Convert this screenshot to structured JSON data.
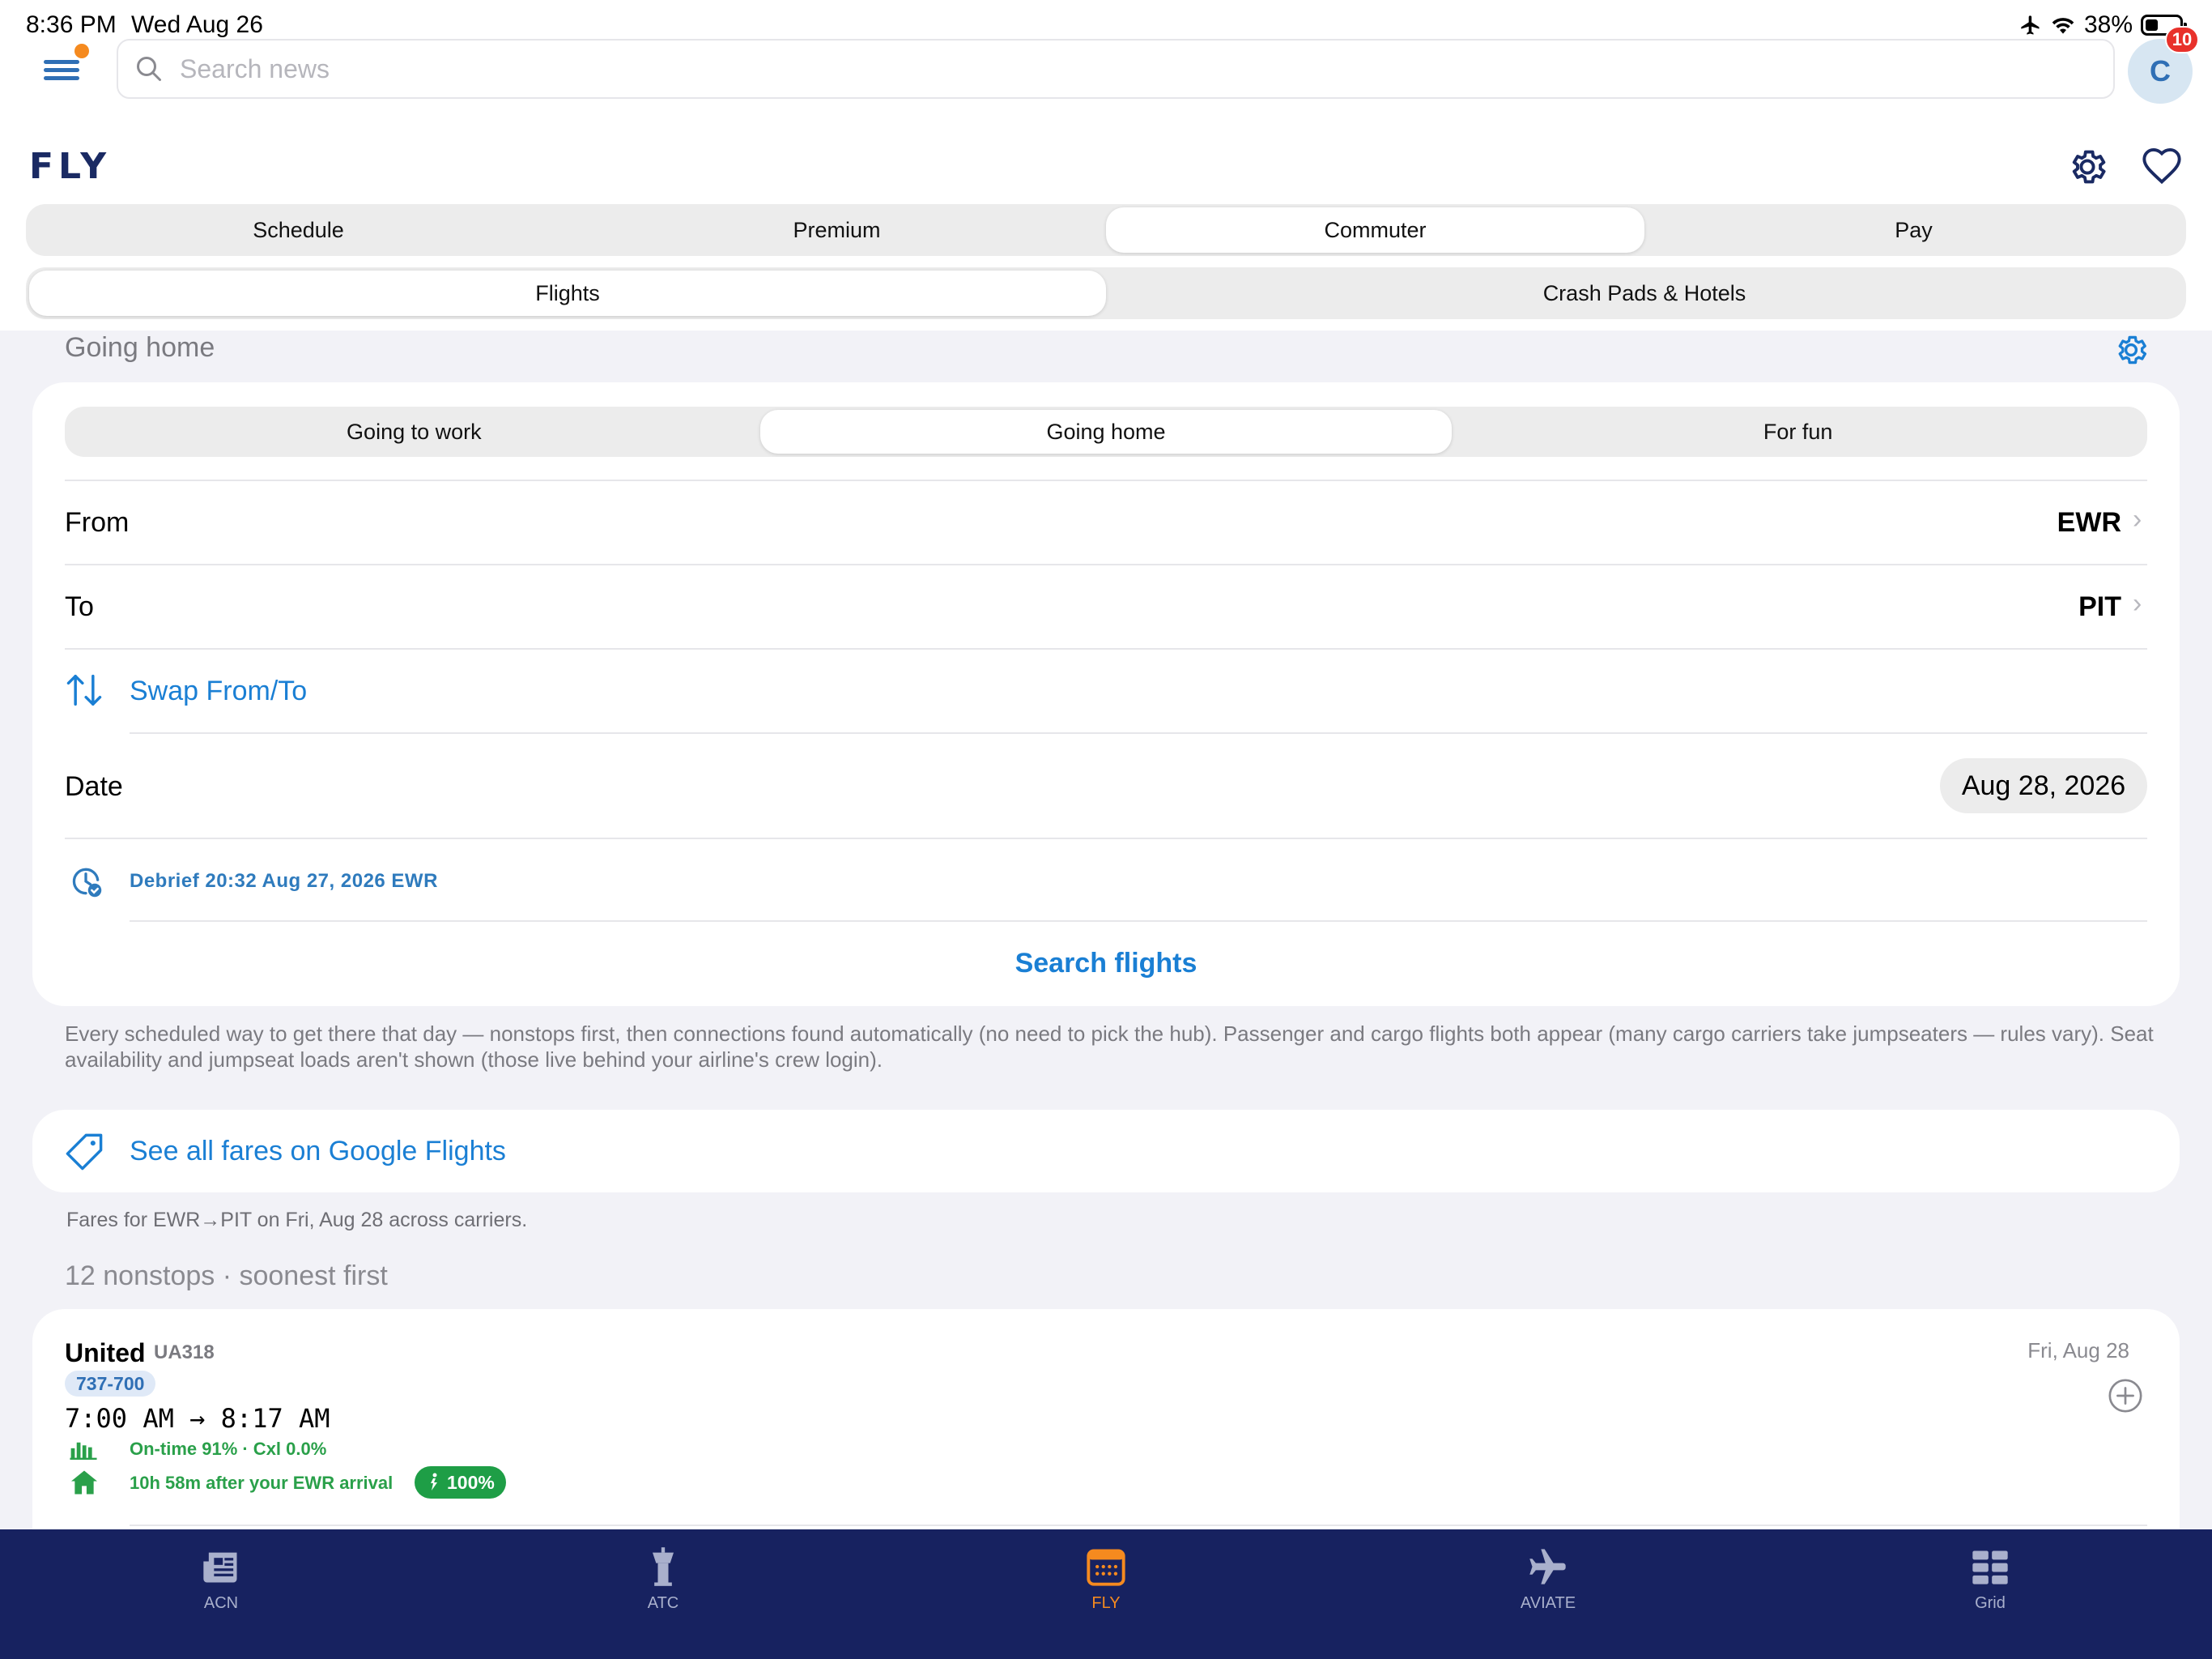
{
  "status_bar": {
    "time": "8:36 PM",
    "date": "Wed Aug 26",
    "battery": "38%",
    "battery_level": 0.38
  },
  "top_bar": {
    "search_placeholder": "Search news",
    "avatar_initial": "C",
    "notification_count": "10"
  },
  "header": {
    "title": "FLY"
  },
  "main_tabs": [
    "Schedule",
    "Premium",
    "Commuter",
    "Pay"
  ],
  "main_tabs_active": "Commuter",
  "sub_tabs": [
    "Flights",
    "Crash Pads & Hotels"
  ],
  "sub_tabs_active": "Flights",
  "section": {
    "heading": "Going home"
  },
  "trip_types": [
    "Going to work",
    "Going home",
    "For fun"
  ],
  "trip_type_active": "Going home",
  "form": {
    "from_label": "From",
    "from_value": "EWR",
    "to_label": "To",
    "to_value": "PIT",
    "swap_label": "Swap From/To",
    "date_label": "Date",
    "date_value": "Aug 28, 2026",
    "debrief": "Debrief 20:32 Aug 27, 2026 EWR",
    "search_button": "Search flights"
  },
  "info_text": "Every scheduled way to get there that day — nonstops first, then connections found automatically (no need to pick the hub). Passenger and cargo flights both appear (many cargo carriers take jumpseaters — rules vary). Seat availability and jumpseat loads aren't shown (those live behind your airline's crew login).",
  "fares": {
    "link_label": "See all fares on Google Flights",
    "note": "Fares for EWR→PIT on Fri, Aug 28 across carriers."
  },
  "results": {
    "heading": "12 nonstops · soonest first",
    "flights": [
      {
        "airline": "United",
        "flight_number": "UA318",
        "aircraft": "737-700",
        "date": "Fri, Aug 28",
        "times": "7:00 AM → 8:17 AM",
        "ontime": "On-time 91% · Cxl 0.0%",
        "arrival_gap": "10h 58m after your EWR arrival",
        "score": "100%"
      }
    ]
  },
  "tab_bar": {
    "items": [
      "ACN",
      "ATC",
      "FLY",
      "AVIATE",
      "Grid"
    ],
    "active": "FLY"
  },
  "colors": {
    "accent": "#1a7fd4",
    "brand_navy": "#172260",
    "active_tab": "#f58a1f",
    "success": "#1e9e46"
  }
}
